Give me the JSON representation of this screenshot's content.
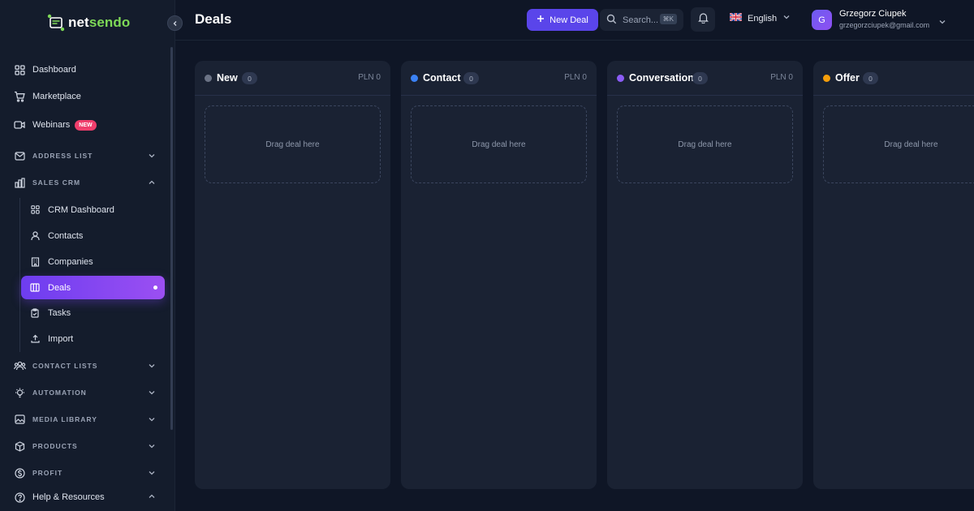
{
  "app": {
    "logo_text_a": "net",
    "logo_text_b": "sendo",
    "accent_color": "#7ed957",
    "primary_color": "#5a45ea"
  },
  "sidebar": {
    "items": [
      {
        "label": "Dashboard",
        "icon": "grid-icon"
      },
      {
        "label": "Marketplace",
        "icon": "cart-icon"
      },
      {
        "label": "Webinars",
        "icon": "video-icon",
        "badge": "NEW"
      }
    ],
    "sections": [
      {
        "label": "ADDRESS LIST",
        "icon": "mail-icon",
        "expanded": false
      },
      {
        "label": "SALES CRM",
        "icon": "chart-bar-icon",
        "expanded": true
      },
      {
        "label": "CONTACT LISTS",
        "icon": "users-icon",
        "expanded": false
      },
      {
        "label": "AUTOMATION",
        "icon": "bulb-icon",
        "expanded": false
      },
      {
        "label": "MEDIA LIBRARY",
        "icon": "image-icon",
        "expanded": false
      },
      {
        "label": "PRODUCTS",
        "icon": "box-icon",
        "expanded": false
      },
      {
        "label": "PROFIT",
        "icon": "dollar-icon",
        "expanded": false
      }
    ],
    "crm_items": [
      {
        "label": "CRM Dashboard",
        "icon": "grid-icon"
      },
      {
        "label": "Contacts",
        "icon": "user-icon"
      },
      {
        "label": "Companies",
        "icon": "building-icon"
      },
      {
        "label": "Deals",
        "icon": "columns-icon",
        "active": true
      },
      {
        "label": "Tasks",
        "icon": "clipboard-icon"
      },
      {
        "label": "Import",
        "icon": "upload-icon"
      }
    ],
    "help": {
      "label": "Help & Resources",
      "icon": "help-circle-icon"
    }
  },
  "header": {
    "title": "Deals",
    "new_deal_label": "New Deal",
    "search_placeholder": "Search...",
    "search_shortcut": "⌘K",
    "language": "English",
    "user": {
      "initial": "G",
      "name": "Grzegorz Ciupek",
      "email": "grzegorzciupek@gmail.com"
    }
  },
  "board": {
    "columns": [
      {
        "title": "New",
        "count": "0",
        "total": "PLN 0",
        "color": "#6b7385",
        "drop_text": "Drag deal here"
      },
      {
        "title": "Contact",
        "count": "0",
        "total": "PLN 0",
        "color": "#3b82f6",
        "drop_text": "Drag deal here"
      },
      {
        "title": "Conversation",
        "count": "0",
        "total": "PLN 0",
        "color": "#8b5cf6",
        "drop_text": "Drag deal here"
      },
      {
        "title": "Offer",
        "count": "0",
        "total": "",
        "color": "#f59e0b",
        "drop_text": "Drag deal here"
      }
    ]
  }
}
